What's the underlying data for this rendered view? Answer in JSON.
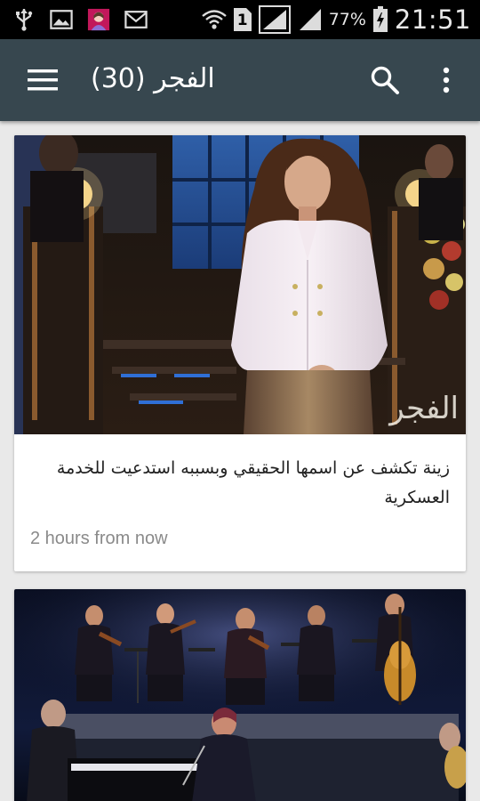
{
  "status_bar": {
    "left_icons": [
      "usb-icon",
      "image-icon",
      "photo-thumbnail-icon",
      "gmail-icon"
    ],
    "right_icons": [
      "wifi-icon",
      "sim1-icon",
      "signal-strong-icon",
      "signal-icon",
      "battery-charging-icon"
    ],
    "sim_label": "1",
    "battery_percent": "77%",
    "time": "21:51"
  },
  "app_bar": {
    "title": "الفجر (30)",
    "background": "#37474f"
  },
  "cards": [
    {
      "headline": "زينة تكشف عن اسمها الحقيقي وبسببه استدعيت للخدمة العسكرية",
      "time": "2 hours from now",
      "image_watermark": "الفجر"
    },
    {
      "headline": "",
      "time": ""
    }
  ]
}
